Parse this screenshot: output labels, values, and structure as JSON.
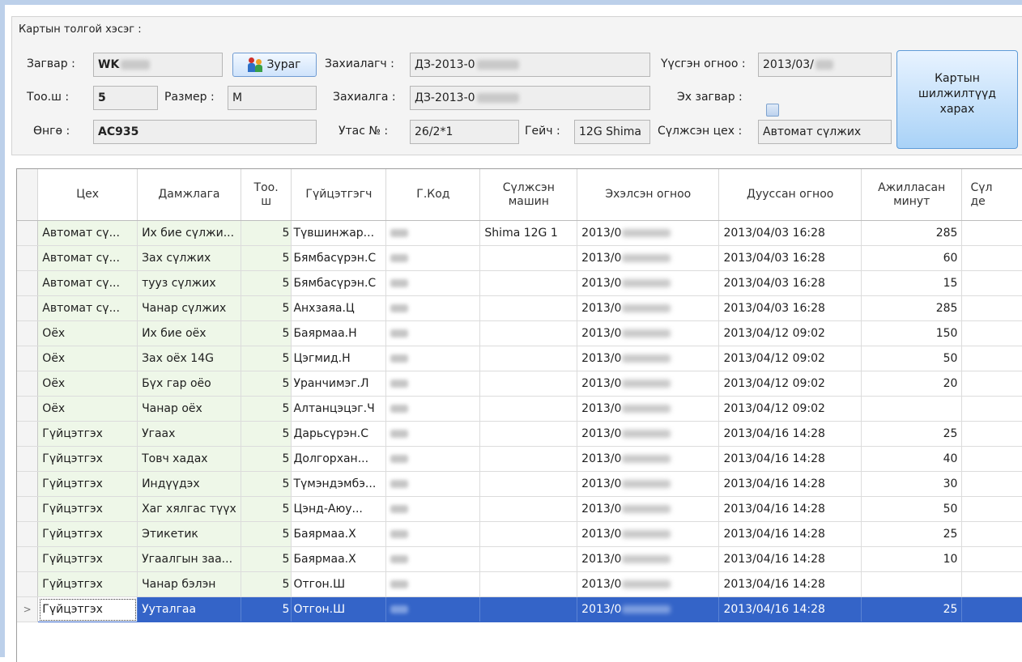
{
  "header": {
    "caption": "Картын толгой хэсэг :",
    "model_label": "Загвар :",
    "model_value": "WK",
    "image_button_label": "Зураг",
    "customer_label": "Захиалагч :",
    "customer_value": "ДЗ-2013-0",
    "created_date_label": "Үүсгэн огноо :",
    "created_date_value": "2013/03/",
    "qty_label": "Тоо.ш :",
    "qty_value": "5",
    "size_label": "Размер :",
    "size_value": "M",
    "order_label": "Захиалга :",
    "order_value": "ДЗ-2013-0",
    "base_model_label": "Эх загвар :",
    "color_label": "Өнгө :",
    "color_value": "AC935",
    "thread_label": "Утас №  :",
    "thread_value": "26/2*1",
    "gauge_label": "Гейч :",
    "gauge_value": "12G Shima",
    "knit_shop_label": "Сүлжсэн цех :",
    "knit_shop_value": "Автомат сүлжих",
    "transfers_button_label": "Картын\nшилжилтүүд\nхарах"
  },
  "grid": {
    "columns": [
      "Цех",
      "Дамжлага",
      "Тоо.\nш",
      "Гүйцэтгэгч",
      "Г.Код",
      "Сүлжсэн\nмашин",
      "Эхэлсэн огноо",
      "Дууссан огноо",
      "Ажилласан\nминут",
      "Сүл\nде"
    ],
    "rows": [
      {
        "shop": "Автомат сү...",
        "stage": "Их бие сүлжи...",
        "qty": "5",
        "worker": "Түвшинжар...",
        "machine": "Shima 12G 1",
        "start": "2013/0",
        "end": "2013/04/03 16:28",
        "minutes": "285"
      },
      {
        "shop": "Автомат сү...",
        "stage": "Зах сүлжих",
        "qty": "5",
        "worker": "Бямбасүрэн.С",
        "machine": "",
        "start": "2013/0",
        "end": "2013/04/03 16:28",
        "minutes": "60"
      },
      {
        "shop": "Автомат сү...",
        "stage": "тууз сүлжих",
        "qty": "5",
        "worker": "Бямбасүрэн.С",
        "machine": "",
        "start": "2013/0",
        "end": "2013/04/03 16:28",
        "minutes": "15"
      },
      {
        "shop": "Автомат сү...",
        "stage": "Чанар сүлжих",
        "qty": "5",
        "worker": "Анхзаяа.Ц",
        "machine": "",
        "start": "2013/0",
        "end": "2013/04/03 16:28",
        "minutes": "285"
      },
      {
        "shop": "Оёх",
        "stage": "Их бие оёх",
        "qty": "5",
        "worker": "Баярмаа.Н",
        "machine": "",
        "start": "2013/0",
        "end": "2013/04/12 09:02",
        "minutes": "150"
      },
      {
        "shop": "Оёх",
        "stage": "Зах оёх 14G",
        "qty": "5",
        "worker": "Цэгмид.Н",
        "machine": "",
        "start": "2013/0",
        "end": "2013/04/12 09:02",
        "minutes": "50"
      },
      {
        "shop": "Оёх",
        "stage": "Бүх гар оёо",
        "qty": "5",
        "worker": "Уранчимэг.Л",
        "machine": "",
        "start": "2013/0",
        "end": "2013/04/12 09:02",
        "minutes": "20"
      },
      {
        "shop": "Оёх",
        "stage": "Чанар оёх",
        "qty": "5",
        "worker": "Алтанцэцэг.Ч",
        "machine": "",
        "start": "2013/0",
        "end": "2013/04/12 09:02",
        "minutes": ""
      },
      {
        "shop": "Гүйцэтгэх",
        "stage": "Угаах",
        "qty": "5",
        "worker": "Дарьсүрэн.С",
        "machine": "",
        "start": "2013/0",
        "end": "2013/04/16 14:28",
        "minutes": "25"
      },
      {
        "shop": "Гүйцэтгэх",
        "stage": "Товч хадах",
        "qty": "5",
        "worker": "Долгорхан...",
        "machine": "",
        "start": "2013/0",
        "end": "2013/04/16 14:28",
        "minutes": "40"
      },
      {
        "shop": "Гүйцэтгэх",
        "stage": "Индүүдэх",
        "qty": "5",
        "worker": "Түмэндэмбэ...",
        "machine": "",
        "start": "2013/0",
        "end": "2013/04/16 14:28",
        "minutes": "30"
      },
      {
        "shop": "Гүйцэтгэх",
        "stage": "Хаг хялгас түүх",
        "qty": "5",
        "worker": "Цэнд-Аюу...",
        "machine": "",
        "start": "2013/0",
        "end": "2013/04/16 14:28",
        "minutes": "50"
      },
      {
        "shop": "Гүйцэтгэх",
        "stage": "Этикетик",
        "qty": "5",
        "worker": "Баярмаа.Х",
        "machine": "",
        "start": "2013/0",
        "end": "2013/04/16 14:28",
        "minutes": "25"
      },
      {
        "shop": "Гүйцэтгэх",
        "stage": "Угаалгын заа...",
        "qty": "5",
        "worker": "Баярмаа.Х",
        "machine": "",
        "start": "2013/0",
        "end": "2013/04/16 14:28",
        "minutes": "10"
      },
      {
        "shop": "Гүйцэтгэх",
        "stage": "Чанар бэлэн",
        "qty": "5",
        "worker": "Отгон.Ш",
        "machine": "",
        "start": "2013/0",
        "end": "2013/04/16 14:28",
        "minutes": ""
      },
      {
        "shop": "Гүйцэтгэх",
        "stage": "Ууталгаа",
        "qty": "5",
        "worker": "Отгон.Ш",
        "machine": "",
        "start": "2013/0",
        "end": "2013/04/16 14:28",
        "minutes": "25"
      }
    ],
    "selected_row_index": 15,
    "current_row_indicator": ">",
    "colors": {
      "selected_row": "#3464c8",
      "pale_green_column": "#eef7e8"
    }
  }
}
